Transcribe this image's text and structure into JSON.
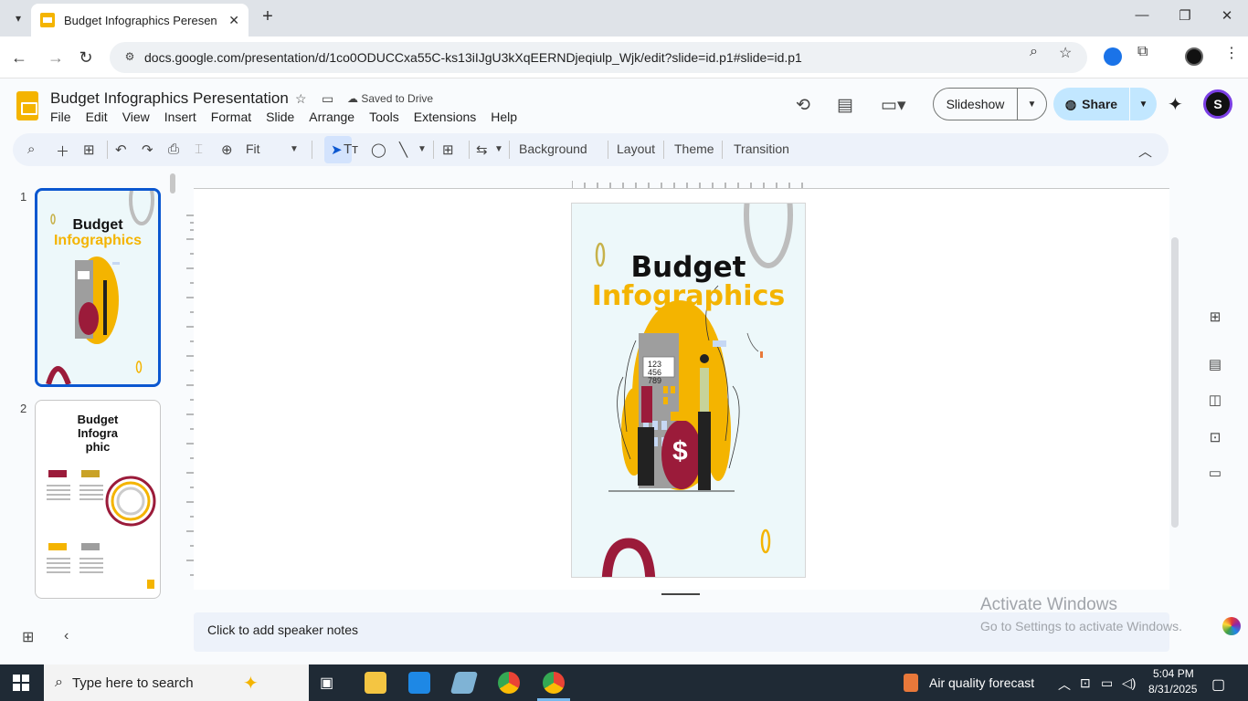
{
  "browser": {
    "tab_title": "Budget Infographics Peresentat",
    "url": "docs.google.com/presentation/d/1co0ODUCCxa55C-ks13iIJgU3kXqEERNDjeqiulp_Wjk/edit?slide=id.p1#slide=id.p1",
    "new_tab": "+",
    "close": "✕",
    "minimize": "—",
    "maximize": "❐"
  },
  "doc": {
    "title": "Budget Infographics Peresentation",
    "saved_status": "Saved to Drive",
    "menu": [
      "File",
      "Edit",
      "View",
      "Insert",
      "Format",
      "Slide",
      "Arrange",
      "Tools",
      "Extensions",
      "Help"
    ],
    "slideshow_label": "Slideshow",
    "share_label": "Share",
    "avatar_initial": "S"
  },
  "toolbar": {
    "zoom": "Fit",
    "background": "Background",
    "layout": "Layout",
    "theme": "Theme",
    "transition": "Transition"
  },
  "filmstrip": {
    "slides": [
      {
        "num": "1",
        "title_line1": "Budget",
        "title_line2": "Infographics"
      },
      {
        "num": "2",
        "title_line1": "Budget",
        "title_line2": "Infogra",
        "title_line3": "phic"
      }
    ]
  },
  "slide": {
    "title_line1": "Budget",
    "title_line2": "Infographics",
    "calc_line1": "123",
    "calc_line2": "456",
    "calc_line3": "789",
    "dollar": "$"
  },
  "notes": {
    "placeholder": "Click to add speaker notes"
  },
  "watermark": {
    "line1": "Activate Windows",
    "line2": "Go to Settings to activate Windows."
  },
  "taskbar": {
    "search_placeholder": "Type here to search",
    "weather": "Air quality forecast",
    "time": "5:04 PM",
    "date": "8/31/2025"
  },
  "colors": {
    "accent_blue": "#0b57d0",
    "share_bg": "#c2e7ff",
    "brand_yellow": "#f4b400",
    "maroon": "#9b1b3a"
  }
}
